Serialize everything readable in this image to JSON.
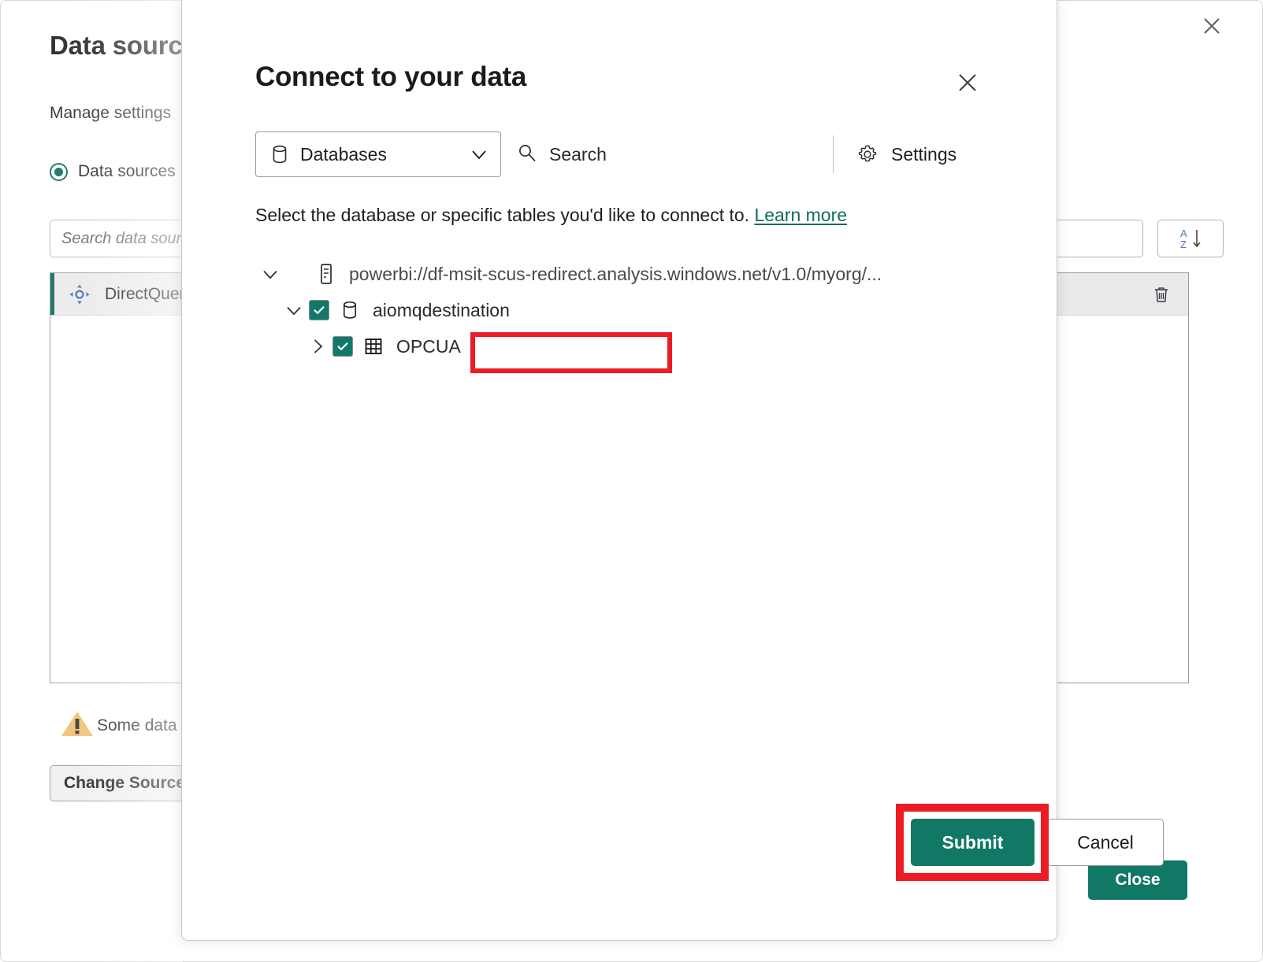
{
  "background": {
    "title": "Data sources",
    "subtitle": "Manage settings",
    "radio_label": "Data sources",
    "search_placeholder": "Search data sources",
    "sort_icon": "sort-az-icon",
    "close_x_icon": "close-icon",
    "list": {
      "rows": [
        {
          "icon": "directquery-icon",
          "label": "DirectQuery",
          "delete_icon": "trash-icon",
          "selected": true
        }
      ]
    },
    "warning": {
      "icon": "warning-triangle-icon",
      "text": "Some data sources"
    },
    "change_source_label": "Change Source",
    "close_label": "Close",
    "accent_color": "#0f6b5c"
  },
  "dialog": {
    "title": "Connect to your data",
    "close_icon": "close-icon",
    "toolbar": {
      "dropdown": {
        "icon": "database-icon",
        "value": "Databases",
        "chevron": "chevron-down-icon",
        "options": [
          "Databases"
        ]
      },
      "search": {
        "icon": "search-icon",
        "label": "Search"
      },
      "settings": {
        "icon": "gear-icon",
        "label": "Settings"
      }
    },
    "description": {
      "text": "Select the database or specific tables you'd like to connect to.",
      "link_label": "Learn more",
      "link_color": "#0f6b5c"
    },
    "tree": [
      {
        "level": 1,
        "twisty": "chevron-down-icon",
        "has_checkbox": false,
        "icon": "server-icon",
        "label": "powerbi://df-msit-scus-redirect.analysis.windows.net/v1.0/myorg/...",
        "checked": false,
        "expanded": true
      },
      {
        "level": 2,
        "twisty": "chevron-down-icon",
        "has_checkbox": true,
        "icon": "database-icon",
        "label": "aiomqdestination",
        "checked": true,
        "expanded": true
      },
      {
        "level": 3,
        "twisty": "chevron-right-icon",
        "has_checkbox": true,
        "icon": "table-icon",
        "label": "OPCUA",
        "checked": true,
        "expanded": false,
        "highlighted": true
      }
    ],
    "footer": {
      "submit_label": "Submit",
      "cancel_label": "Cancel",
      "submit_color": "#117865",
      "highlighted": "submit"
    },
    "highlight_color": "#ed1c24"
  }
}
